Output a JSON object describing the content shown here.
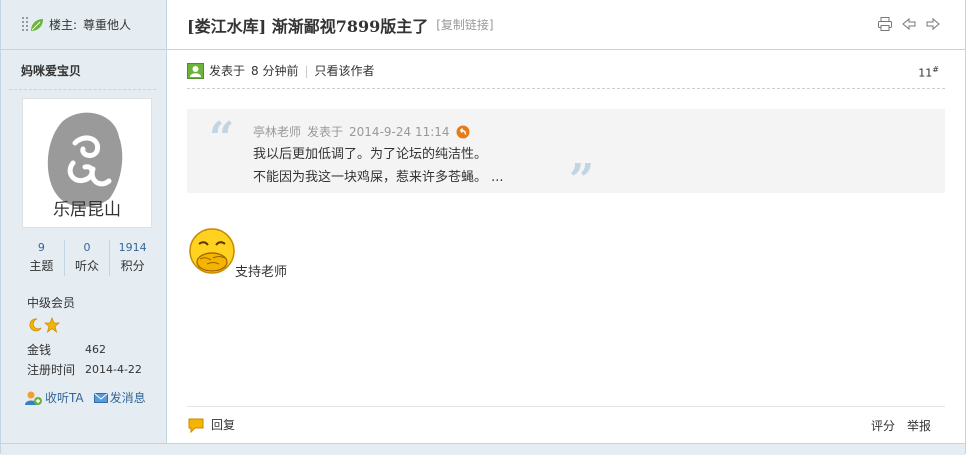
{
  "sidebar": {
    "louzhu_label": "楼主:",
    "louzhu_value": "尊重他人",
    "username": "妈咪爱宝贝",
    "avatar_text": "乐居昆山",
    "stats": [
      {
        "num": "9",
        "label": "主题"
      },
      {
        "num": "0",
        "label": "听众"
      },
      {
        "num": "1914",
        "label": "积分"
      }
    ],
    "grade": "中级会员",
    "money_label": "金钱",
    "money_value": "462",
    "reg_label": "注册时间",
    "reg_value": "2014-4-22",
    "follow_label": "收听TA",
    "message_label": "发消息"
  },
  "thread": {
    "title": "[娄江水库] 渐渐鄙视7899版主了",
    "copy_link": "[复制链接]"
  },
  "post": {
    "posted_prefix": "发表于",
    "posted_time": "8 分钟前",
    "author_only": "只看该作者",
    "floor": "11",
    "floor_suffix": "#",
    "quote_author": "亭林老师",
    "quote_prefix": "发表于",
    "quote_time": "2014-9-24 11:14",
    "quote_line1": "我以后更加低调了。为了论坛的纯洁性。",
    "quote_line2": "不能因为我这一块鸡屎，惹来许多苍蝇。 ...",
    "body": "支持老师"
  },
  "footer": {
    "reply": "回复",
    "rate": "评分",
    "report": "举报"
  }
}
